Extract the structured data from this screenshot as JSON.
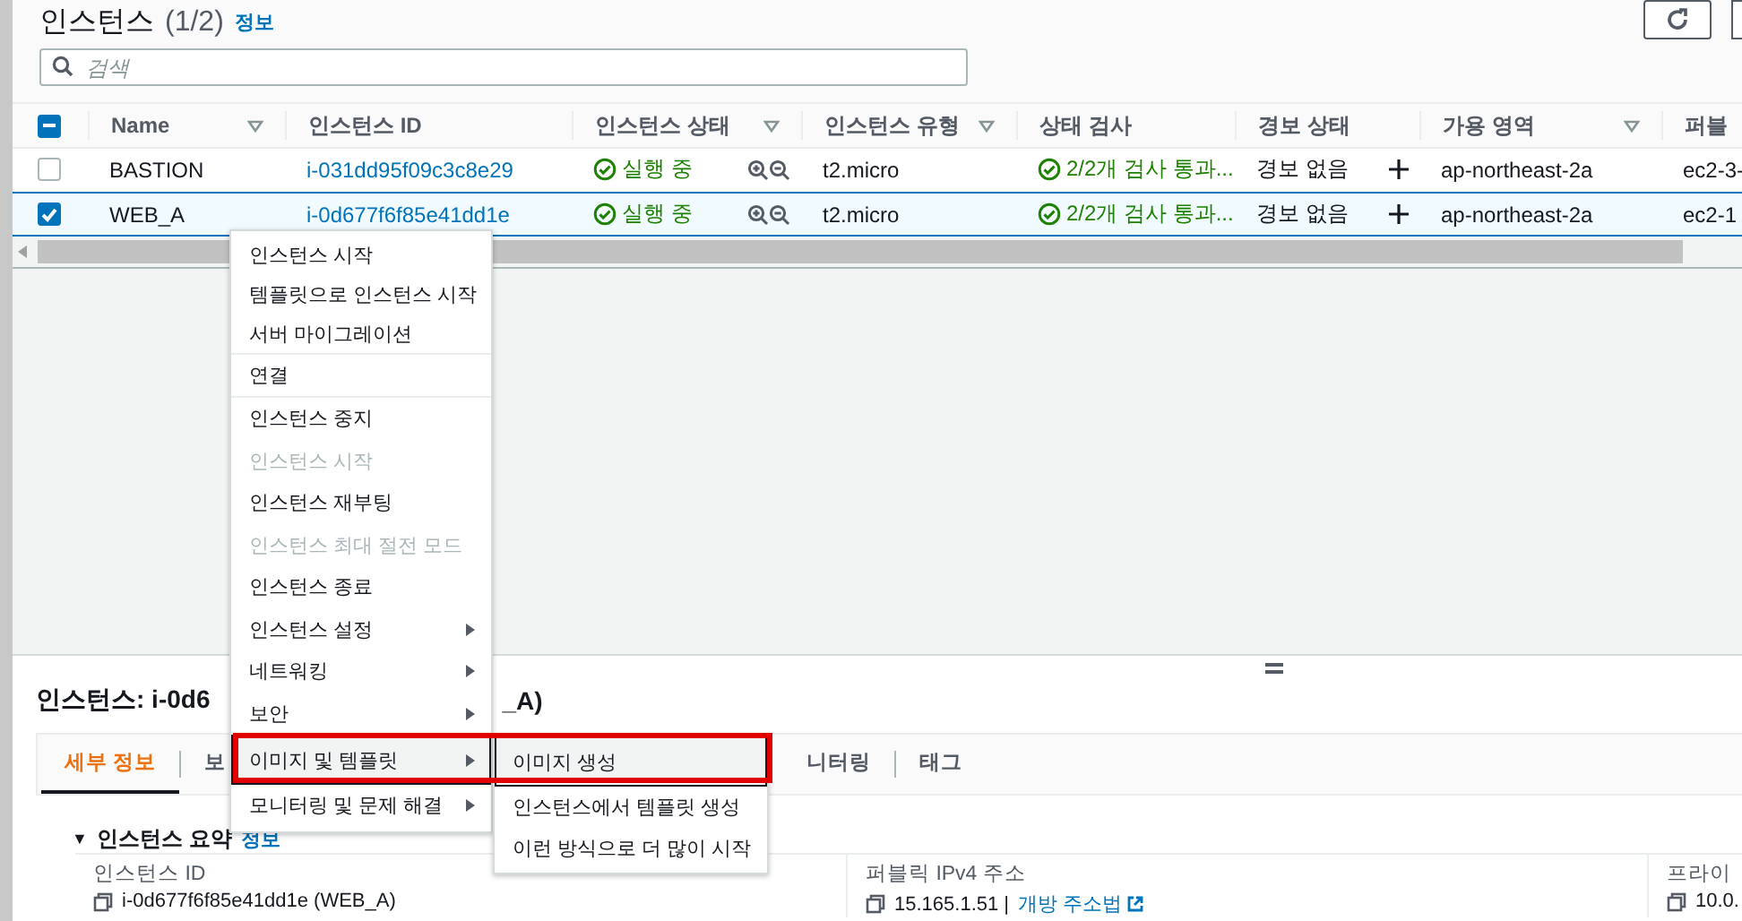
{
  "header": {
    "title": "인스턴스",
    "count": "(1/2)",
    "info_link": "정보"
  },
  "search": {
    "placeholder": "검색"
  },
  "table": {
    "select_all_partial": true,
    "columns": [
      {
        "label": "Name",
        "filterable": true
      },
      {
        "label": "인스턴스 ID",
        "filterable": false
      },
      {
        "label": "인스턴스 상태",
        "filterable": true
      },
      {
        "label": "인스턴스 유형",
        "filterable": true
      },
      {
        "label": "상태 검사",
        "filterable": false
      },
      {
        "label": "경보 상태",
        "filterable": false
      },
      {
        "label": "가용 영역",
        "filterable": true
      },
      {
        "label": "퍼블"
      }
    ],
    "rows": [
      {
        "selected": false,
        "name": "BASTION",
        "id": "i-031dd95f09c3c8e29",
        "state": "실행 중",
        "type": "t2.micro",
        "status_check": "2/2개 검사 통과...",
        "alarm": "경보 없음",
        "zone": "ap-northeast-2a",
        "public_dns": "ec2-3-"
      },
      {
        "selected": true,
        "name": "WEB_A",
        "id": "i-0d677f6f85e41dd1e",
        "state": "실행 중",
        "type": "t2.micro",
        "status_check": "2/2개 검사 통과...",
        "alarm": "경보 없음",
        "zone": "ap-northeast-2a",
        "public_dns": "ec2-1"
      }
    ]
  },
  "context_menu": {
    "groups": [
      [
        {
          "label": "인스턴스 시작",
          "disabled": false,
          "submenu": false,
          "selected": false
        },
        {
          "label": "템플릿으로 인스턴스 시작",
          "disabled": false,
          "submenu": false,
          "selected": false
        },
        {
          "label": "서버 마이그레이션",
          "disabled": false,
          "submenu": false,
          "selected": false
        }
      ],
      [
        {
          "label": "연결",
          "disabled": false,
          "submenu": false,
          "selected": false
        }
      ],
      [
        {
          "label": "인스턴스 중지",
          "disabled": false,
          "submenu": false,
          "selected": false
        },
        {
          "label": "인스턴스 시작",
          "disabled": true,
          "submenu": false,
          "selected": false
        },
        {
          "label": "인스턴스 재부팅",
          "disabled": false,
          "submenu": false,
          "selected": false
        },
        {
          "label": "인스턴스 최대 절전 모드",
          "disabled": true,
          "submenu": false,
          "selected": false
        },
        {
          "label": "인스턴스 종료",
          "disabled": false,
          "submenu": false,
          "selected": false
        },
        {
          "label": "인스턴스 설정",
          "disabled": false,
          "submenu": true,
          "selected": false
        },
        {
          "label": "네트워킹",
          "disabled": false,
          "submenu": true,
          "selected": false
        },
        {
          "label": "보안",
          "disabled": false,
          "submenu": true,
          "selected": false
        },
        {
          "label": "이미지 및 템플릿",
          "disabled": false,
          "submenu": true,
          "selected": true
        },
        {
          "label": "모니터링 및 문제 해결",
          "disabled": false,
          "submenu": true,
          "selected": false
        }
      ]
    ],
    "submenu": [
      {
        "label": "이미지 생성",
        "selected": true
      },
      {
        "label": "인스턴스에서 템플릿 생성",
        "selected": false
      },
      {
        "label": "이런 방식으로 더 많이 시작",
        "selected": false
      }
    ]
  },
  "details": {
    "title_start": "인스턴스: i-0d6",
    "title_end": "_A)",
    "tabs": [
      {
        "label": "세부 정보",
        "selected": true
      },
      {
        "label": "보",
        "selected": false
      },
      {
        "label": "니터링",
        "selected": false
      },
      {
        "label": "태그",
        "selected": false
      }
    ],
    "summary": {
      "toggle": "▼",
      "title": "인스턴스 요약",
      "info_link": "정보"
    },
    "fields": [
      {
        "label": "인스턴스 ID",
        "value": "i-0d677f6f85e41dd1e (WEB_A)"
      },
      {
        "label": "퍼블릭 IPv4 주소",
        "value": "15.165.1.51 |",
        "link": "개방 주소법"
      },
      {
        "label": "프라이",
        "value": "10.0."
      }
    ]
  }
}
